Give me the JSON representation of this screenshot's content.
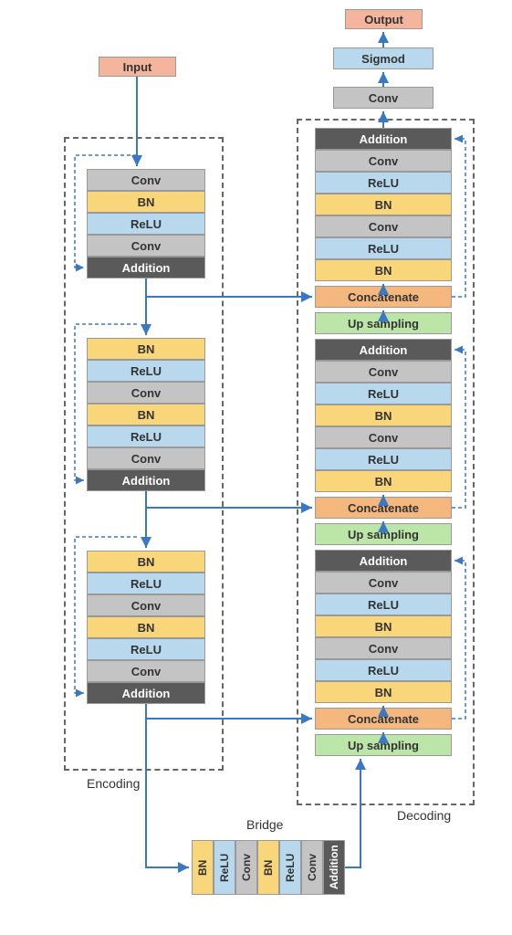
{
  "colors": {
    "input": "#f4b59c",
    "conv": "#c4c4c4",
    "bn": "#f9d67a",
    "relu": "#b8d9ed",
    "addition": "#5a5a5a",
    "concat": "#f4b77e",
    "upsamp": "#bce6a8",
    "arrow": "#3b78c4"
  },
  "header": {
    "input": "Input",
    "output": "Output",
    "sigmod": "Sigmod",
    "conv": "Conv"
  },
  "encoding": {
    "label": "Encoding",
    "block1": [
      "Conv",
      "BN",
      "ReLU",
      "Conv",
      "Addition"
    ],
    "block2": [
      "BN",
      "ReLU",
      "Conv",
      "BN",
      "ReLU",
      "Conv",
      "Addition"
    ],
    "block3": [
      "BN",
      "ReLU",
      "Conv",
      "BN",
      "ReLU",
      "Conv",
      "Addition"
    ]
  },
  "decoding": {
    "label": "Decoding",
    "block1": [
      "Addition",
      "Conv",
      "ReLU",
      "BN",
      "Conv",
      "ReLU",
      "BN",
      "Concatenate",
      "Up sampling"
    ],
    "block2": [
      "Addition",
      "Conv",
      "ReLU",
      "BN",
      "Conv",
      "ReLU",
      "BN",
      "Concatenate",
      "Up sampling"
    ],
    "block3": [
      "Addition",
      "Conv",
      "ReLU",
      "BN",
      "Conv",
      "ReLU",
      "BN",
      "Concatenate",
      "Up sampling"
    ]
  },
  "bridge": {
    "label": "Bridge",
    "layers": [
      "BN",
      "ReLU",
      "Conv",
      "BN",
      "ReLU",
      "Conv",
      "Addition"
    ]
  }
}
